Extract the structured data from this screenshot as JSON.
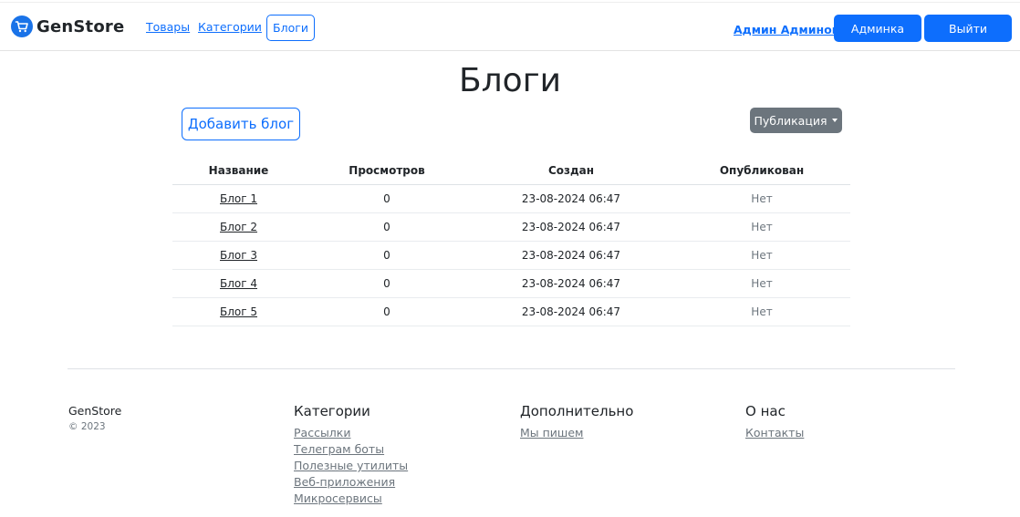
{
  "header": {
    "brand": "GenStore",
    "nav": [
      "Товары",
      "Категории"
    ],
    "active_nav": "Блоги",
    "user": "Админ Админов",
    "admin_button": "Админка",
    "logout_button": "Выйти"
  },
  "main": {
    "title": "Блоги",
    "add_button": "Добавить блог",
    "filter_dropdown": "Публикация",
    "table": {
      "columns": [
        "Название",
        "Просмотров",
        "Создан",
        "Опубликован"
      ],
      "rows": [
        [
          "Блог 1",
          "0",
          "23-08-2024 06:47",
          "Нет"
        ],
        [
          "Блог 2",
          "0",
          "23-08-2024 06:47",
          "Нет"
        ],
        [
          "Блог 3",
          "0",
          "23-08-2024 06:47",
          "Нет"
        ],
        [
          "Блог 4",
          "0",
          "23-08-2024 06:47",
          "Нет"
        ],
        [
          "Блог 5",
          "0",
          "23-08-2024 06:47",
          "Нет"
        ]
      ]
    }
  },
  "footer": {
    "brand": "GenStore",
    "copyright": "© 2023",
    "columns": [
      {
        "title": "Категории",
        "links": [
          "Рассылки",
          "Телеграм боты",
          "Полезные утилиты",
          "Веб-приложения",
          "Микросервисы"
        ]
      },
      {
        "title": "Дополнительно",
        "links": [
          "Мы пишем"
        ]
      },
      {
        "title": "О нас",
        "links": [
          "Контакты"
        ]
      }
    ]
  },
  "colors": {
    "primary": "#0d6efd",
    "secondary": "#6c757d",
    "logo": "#1a73e8"
  },
  "icons": {
    "brand": "shopping-cart-icon",
    "dropdown": "caret-down-icon"
  }
}
